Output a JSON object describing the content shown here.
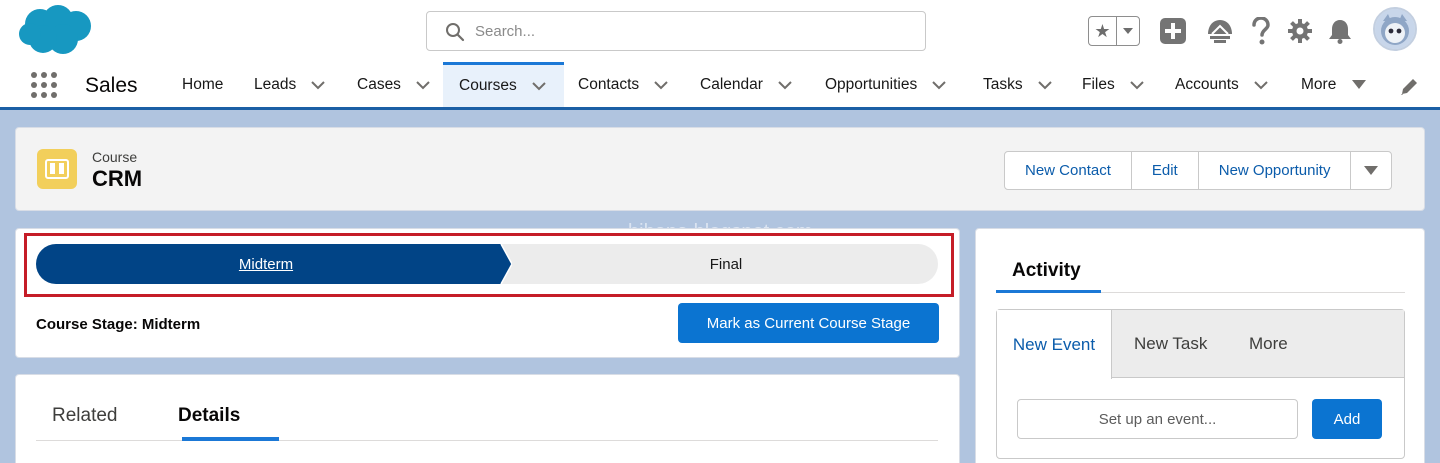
{
  "search": {
    "placeholder": "Search..."
  },
  "nav": {
    "app_name": "Sales",
    "items": [
      {
        "label": "Home"
      },
      {
        "label": "Leads"
      },
      {
        "label": "Cases"
      },
      {
        "label": "Courses"
      },
      {
        "label": "Contacts"
      },
      {
        "label": "Calendar"
      },
      {
        "label": "Opportunities"
      },
      {
        "label": "Tasks"
      },
      {
        "label": "Files"
      },
      {
        "label": "Accounts"
      },
      {
        "label": "More"
      }
    ],
    "active": "Courses"
  },
  "record": {
    "type_label": "Course",
    "title": "CRM",
    "actions": [
      "New Contact",
      "Edit",
      "New Opportunity"
    ]
  },
  "path": {
    "stages": [
      "Midterm",
      "Final"
    ],
    "current_stage_text": "Course Stage: Midterm",
    "mark_button": "Mark as Current Course Stage"
  },
  "detail_tabs": [
    "Related",
    "Details"
  ],
  "activity": {
    "title": "Activity",
    "tabs": [
      "New Event",
      "New Task",
      "More"
    ],
    "event_input_text": "Set up an event...",
    "add_button": "Add"
  },
  "watermark": "bihana.blogspot.com",
  "colors": {
    "brand_blue": "#0b74d1",
    "path_current": "#014486",
    "highlight_red": "#c51d27",
    "record_icon": "#f2cf5b"
  }
}
